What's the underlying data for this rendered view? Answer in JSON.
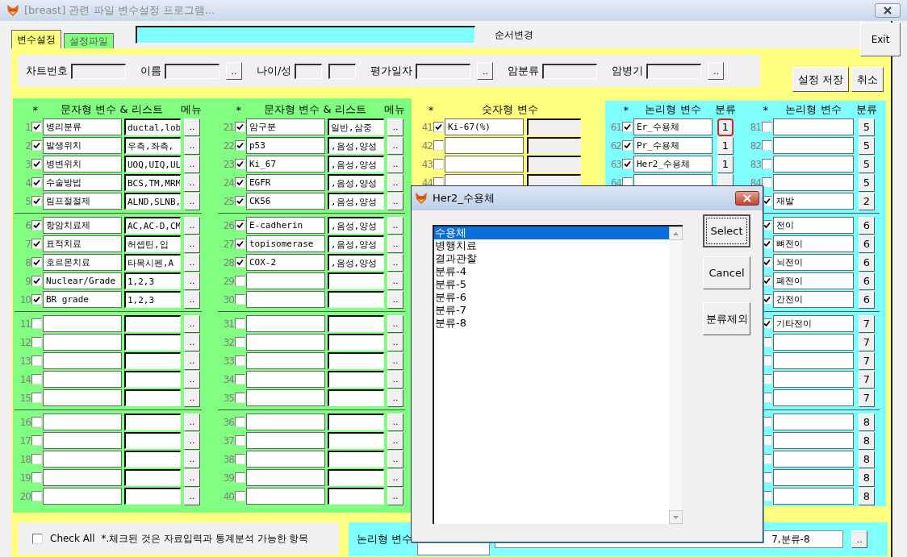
{
  "window": {
    "title": "[breast] 관련 파일 변수설정 프로그램..."
  },
  "tabs": [
    {
      "label": "변수설정",
      "selected": true
    },
    {
      "label": "설정파일",
      "selected": false
    }
  ],
  "order_label": "순서변경",
  "exit_button": "Exit",
  "patient_fields": [
    {
      "kind": "text",
      "label": "차트번호"
    },
    {
      "kind": "lookup",
      "label": "이름",
      "button": ".."
    },
    {
      "kind": "pair",
      "label": "나이/성"
    },
    {
      "kind": "lookup",
      "label": "평가일자",
      "button": ".."
    },
    {
      "kind": "text",
      "label": "암분류"
    },
    {
      "kind": "lookup",
      "label": "암병기",
      "button": ".."
    }
  ],
  "actions": [
    "설정 저장",
    "취소"
  ],
  "string_vars": {
    "columns": [
      {
        "star": "*",
        "title": "문자형 변수 & 리스트",
        "menu": "메뉴",
        "groups": [
          [
            {
              "no": "1",
              "checked": true,
              "name": "병리분류",
              "list": "ductal,lob",
              "button": ".."
            },
            {
              "no": "2",
              "checked": true,
              "name": "발생위치",
              "list": "우측,좌측,",
              "button": ".."
            },
            {
              "no": "3",
              "checked": true,
              "name": "병변위치",
              "list": "UOQ,UIQ,UL",
              "button": ".."
            },
            {
              "no": "4",
              "checked": true,
              "name": "수술방법",
              "list": "BCS,TM,MRM",
              "button": ".."
            },
            {
              "no": "5",
              "checked": true,
              "name": "림프절절제",
              "list": "ALND,SLNB,",
              "button": ".."
            }
          ],
          [
            {
              "no": "6",
              "checked": true,
              "name": "항암치료제",
              "list": "AC,AC-D,CM",
              "button": ".."
            },
            {
              "no": "7",
              "checked": true,
              "name": "표적치료",
              "list": "허셉틴,입",
              "button": ".."
            },
            {
              "no": "8",
              "checked": true,
              "name": "호르몬치료",
              "list": "타목시펜,A",
              "button": ".."
            },
            {
              "no": "9",
              "checked": true,
              "name": "Nuclear/Grade",
              "list": "1,2,3",
              "button": ".."
            },
            {
              "no": "10",
              "checked": true,
              "name": "BR grade",
              "list": "1,2,3",
              "button": ".."
            }
          ],
          [
            {
              "no": "11",
              "checked": false,
              "button": ".."
            },
            {
              "no": "12",
              "checked": false,
              "button": ".."
            },
            {
              "no": "13",
              "checked": false,
              "button": ".."
            },
            {
              "no": "14",
              "checked": false,
              "button": ".."
            },
            {
              "no": "15",
              "checked": false,
              "button": ".."
            }
          ],
          [
            {
              "no": "16",
              "checked": false,
              "button": ".."
            },
            {
              "no": "17",
              "checked": false,
              "button": ".."
            },
            {
              "no": "18",
              "checked": false,
              "button": ".."
            },
            {
              "no": "19",
              "checked": false,
              "button": ".."
            },
            {
              "no": "20",
              "checked": false,
              "button": ".."
            }
          ]
        ]
      },
      {
        "star": "*",
        "title": "문자형 변수 & 리스트",
        "menu": "메뉴",
        "groups": [
          [
            {
              "no": "21",
              "checked": true,
              "name": "암구분",
              "list": "일반,삼중",
              "button": ".."
            },
            {
              "no": "22",
              "checked": true,
              "name": "p53",
              "list": ",음성,양성",
              "button": ".."
            },
            {
              "no": "23",
              "checked": true,
              "name": "Ki_67",
              "list": ",음성,양성",
              "button": ".."
            },
            {
              "no": "24",
              "checked": true,
              "name": "EGFR",
              "list": ",음성,양성",
              "button": ".."
            },
            {
              "no": "25",
              "checked": true,
              "name": "CK56",
              "list": ",음성,양성",
              "button": ".."
            }
          ],
          [
            {
              "no": "26",
              "checked": true,
              "name": "E-cadherin",
              "list": ",음성,양성",
              "button": ".."
            },
            {
              "no": "27",
              "checked": true,
              "name": "topisomerase",
              "list": ",음성,양성",
              "button": ".."
            },
            {
              "no": "28",
              "checked": true,
              "name": "COX-2",
              "list": ",음성,양성",
              "button": ".."
            },
            {
              "no": "29",
              "checked": false,
              "button": ".."
            },
            {
              "no": "30",
              "checked": false,
              "button": ".."
            }
          ],
          [
            {
              "no": "31",
              "checked": false,
              "button": ".."
            },
            {
              "no": "32",
              "checked": false,
              "button": ".."
            },
            {
              "no": "33",
              "checked": false,
              "button": ".."
            },
            {
              "no": "34",
              "checked": false,
              "button": ".."
            },
            {
              "no": "35",
              "checked": false,
              "button": ".."
            }
          ],
          [
            {
              "no": "36",
              "checked": false,
              "button": ".."
            },
            {
              "no": "37",
              "checked": false,
              "button": ".."
            },
            {
              "no": "38",
              "checked": false,
              "button": ".."
            },
            {
              "no": "39",
              "checked": false,
              "button": ".."
            },
            {
              "no": "40",
              "checked": false,
              "button": ".."
            }
          ]
        ]
      }
    ]
  },
  "numeric_vars": {
    "star": "*",
    "title": "숫자형 변수",
    "rows": [
      {
        "no": "41",
        "checked": true,
        "name": "Ki-67(%)"
      },
      {
        "no": "42",
        "checked": false
      },
      {
        "no": "43",
        "checked": false
      },
      {
        "no": "44",
        "checked": false
      }
    ]
  },
  "logical_vars": {
    "columns": [
      {
        "star": "*",
        "title": "논리형 변수",
        "class_title": "분류",
        "groups": [
          [
            {
              "no": "61",
              "checked": true,
              "name": "Er_수용체",
              "class": "1",
              "highlighted": true
            },
            {
              "no": "62",
              "checked": true,
              "name": "Pr_수용체",
              "class": "1",
              "highlighted": false
            },
            {
              "no": "63",
              "checked": true,
              "name": "Her2_수용체",
              "class": "1",
              "highlighted": false
            },
            {
              "no": "64",
              "checked": false,
              "highlighted": false
            }
          ]
        ]
      },
      {
        "star": "*",
        "title": "논리형 변수",
        "class_title": "분류",
        "groups": [
          [
            {
              "no": "81",
              "checked": false,
              "class": "5",
              "highlighted": false
            },
            {
              "no": "82",
              "checked": false,
              "class": "5",
              "highlighted": false
            },
            {
              "no": "83",
              "checked": false,
              "class": "5",
              "highlighted": false
            },
            {
              "no": "84",
              "checked": false,
              "class": "5",
              "highlighted": false
            },
            {
              "checked": true,
              "name": "재발",
              "class": "2",
              "highlighted": false
            }
          ],
          [
            {
              "checked": true,
              "name": "전이",
              "class": "6",
              "highlighted": false
            },
            {
              "checked": true,
              "name": "뼈전이",
              "class": "6",
              "highlighted": false
            },
            {
              "checked": true,
              "name": "뇌전이",
              "class": "6",
              "highlighted": false
            },
            {
              "checked": true,
              "name": "폐전이",
              "class": "6",
              "highlighted": false
            },
            {
              "checked": true,
              "name": "간전이",
              "class": "6",
              "highlighted": false
            }
          ],
          [
            {
              "checked": true,
              "name": "기타전이",
              "class": "7",
              "highlighted": false
            },
            {
              "checked": false,
              "class": "7",
              "highlighted": false
            },
            {
              "checked": false,
              "class": "7",
              "highlighted": false
            },
            {
              "checked": false,
              "class": "7",
              "highlighted": false
            },
            {
              "checked": false,
              "class": "7",
              "highlighted": false
            }
          ],
          [
            {
              "checked": false,
              "class": "8",
              "highlighted": false
            },
            {
              "checked": false,
              "class": "8",
              "highlighted": false
            },
            {
              "checked": false,
              "class": "8",
              "highlighted": false
            },
            {
              "checked": false,
              "class": "8",
              "highlighted": false
            },
            {
              "checked": false,
              "class": "8",
              "highlighted": false
            }
          ]
        ]
      }
    ]
  },
  "footer": {
    "check_all": {
      "label": "Check All",
      "checked": false
    },
    "note": "*.체크된 것은 자료입력과 통계분석 가능한 항목",
    "logical_label": "논리형 변수",
    "category_value": "7,분류-8",
    "button": ".."
  },
  "dialog": {
    "title": "Her2_수용체",
    "items": [
      {
        "label": "수용체",
        "selected": true
      },
      {
        "label": "병행치료",
        "selected": false
      },
      {
        "label": "결과관찰",
        "selected": false
      },
      {
        "label": "분류-4",
        "selected": false
      },
      {
        "label": "분류-5",
        "selected": false
      },
      {
        "label": "분류-6",
        "selected": false
      },
      {
        "label": "분류-7",
        "selected": false
      },
      {
        "label": "분류-8",
        "selected": false
      }
    ],
    "buttons": [
      {
        "label": "Select",
        "focused": true
      },
      {
        "label": "Cancel",
        "focused": false
      },
      {
        "label": "분류제외",
        "focused": false
      }
    ]
  }
}
